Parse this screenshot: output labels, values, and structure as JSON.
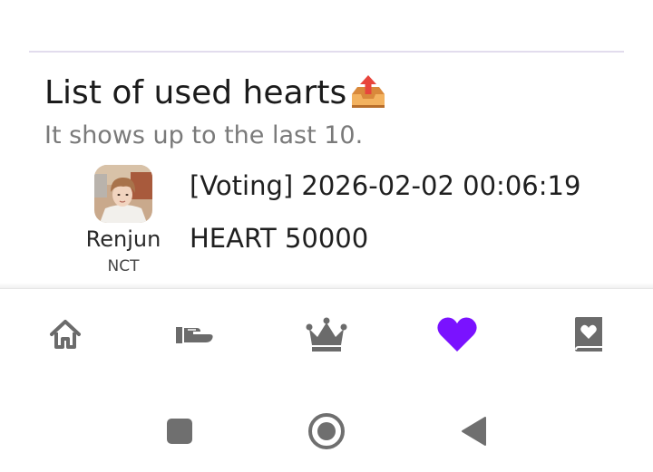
{
  "section": {
    "title": "List of used hearts",
    "title_icon": "outbox-tray-icon",
    "subtitle": "It shows up to the last 10."
  },
  "entries": [
    {
      "idol_name": "Renjun",
      "group": "NCT",
      "line1": "[Voting] 2026-02-02 00:06:19",
      "line2": "HEART 50000"
    }
  ],
  "bottom_nav": {
    "items": [
      {
        "name": "home",
        "icon": "home-icon",
        "color": "#6b6b6b",
        "active": false
      },
      {
        "name": "give",
        "icon": "hand-give-icon",
        "color": "#6b6b6b",
        "active": false
      },
      {
        "name": "ranking",
        "icon": "crown-icon",
        "color": "#6b6b6b",
        "active": false
      },
      {
        "name": "hearts",
        "icon": "heart-icon",
        "color": "#7a12ff",
        "active": true
      },
      {
        "name": "book",
        "icon": "heart-book-icon",
        "color": "#6b6b6b",
        "active": false
      }
    ]
  },
  "system_nav": {
    "buttons": [
      "recents-square-icon",
      "home-circle-icon",
      "back-triangle-icon"
    ],
    "color": "#6f6f6f"
  },
  "colors": {
    "accent": "#7a12ff",
    "divider": "#e2dced",
    "text_primary": "#1b1b1b",
    "text_secondary": "#7a7a7a"
  }
}
